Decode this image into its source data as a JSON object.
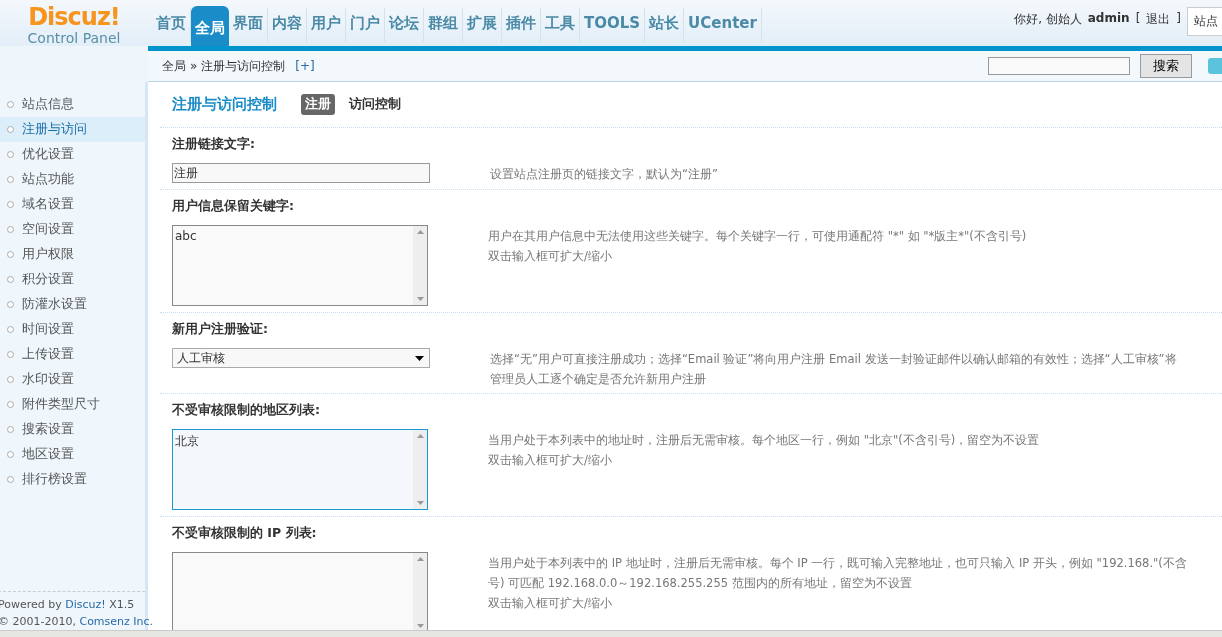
{
  "logo": {
    "name": "Discuz!",
    "subtitle": "Control Panel"
  },
  "nav": [
    {
      "label": "首页",
      "selected": false
    },
    {
      "label": "全局",
      "selected": true
    },
    {
      "label": "界面",
      "selected": false
    },
    {
      "label": "内容",
      "selected": false
    },
    {
      "label": "用户",
      "selected": false
    },
    {
      "label": "门户",
      "selected": false
    },
    {
      "label": "论坛",
      "selected": false
    },
    {
      "label": "群组",
      "selected": false
    },
    {
      "label": "扩展",
      "selected": false
    },
    {
      "label": "插件",
      "selected": false
    },
    {
      "label": "工具",
      "selected": false
    },
    {
      "label": "TOOLS",
      "selected": false
    },
    {
      "label": "站长",
      "selected": false
    },
    {
      "label": "UCenter",
      "selected": false
    }
  ],
  "user": {
    "greeting": "你好, 创始人",
    "name": "admin",
    "logout": "退出",
    "bracket_open": "[",
    "bracket_close": "]",
    "site_button": "站点"
  },
  "breadcrumb": {
    "parent": "全局",
    "separator": "»",
    "current": "注册与访问控制",
    "add": "[+]"
  },
  "search": {
    "button": "搜索"
  },
  "sidebar": {
    "items": [
      {
        "label": "站点信息",
        "selected": false
      },
      {
        "label": "注册与访问",
        "selected": true
      },
      {
        "label": "优化设置",
        "selected": false
      },
      {
        "label": "站点功能",
        "selected": false
      },
      {
        "label": "域名设置",
        "selected": false
      },
      {
        "label": "空间设置",
        "selected": false
      },
      {
        "label": "用户权限",
        "selected": false
      },
      {
        "label": "积分设置",
        "selected": false
      },
      {
        "label": "防灌水设置",
        "selected": false
      },
      {
        "label": "时间设置",
        "selected": false
      },
      {
        "label": "上传设置",
        "selected": false
      },
      {
        "label": "水印设置",
        "selected": false
      },
      {
        "label": "附件类型尺寸",
        "selected": false
      },
      {
        "label": "搜索设置",
        "selected": false
      },
      {
        "label": "地区设置",
        "selected": false
      },
      {
        "label": "排行榜设置",
        "selected": false
      }
    ],
    "footer": [
      {
        "prefix": "Powered by ",
        "link": "Discuz!",
        "suffix": " X1.5"
      },
      {
        "prefix": "© 2001-2010, ",
        "link": "Comsenz Inc."
      }
    ]
  },
  "page": {
    "title": "注册与访问控制",
    "subtabs": [
      {
        "label": "注册",
        "selected": true
      },
      {
        "label": "访问控制",
        "selected": false
      }
    ],
    "settings": [
      {
        "kind": "text",
        "label": "注册链接文字:",
        "value": "注册",
        "focused": false,
        "description": [
          "设置站点注册页的链接文字，默认为“注册”"
        ]
      },
      {
        "kind": "textarea",
        "label": "用户信息保留关键字:",
        "value": "abc",
        "focused": false,
        "description": [
          "用户在其用户信息中无法使用这些关键字。每个关键字一行，可使用通配符 \"*\" 如 \"*版主*\"(不含引号)",
          "双击输入框可扩大/缩小"
        ]
      },
      {
        "kind": "select",
        "label": "新用户注册验证:",
        "value": "人工审核",
        "focused": false,
        "description": [
          "选择“无”用户可直接注册成功；选择“Email 验证”将向用户注册 Email 发送一封验证邮件以确认邮箱的有效性；选择“人工审核”将",
          "管理员人工逐个确定是否允许新用户注册"
        ]
      },
      {
        "kind": "textarea",
        "label": "不受审核限制的地区列表:",
        "value": "北京",
        "focused": true,
        "description": [
          "当用户处于本列表中的地址时，注册后无需审核。每个地区一行，例如 \"北京\"(不含引号)，留空为不设置",
          "双击输入框可扩大/缩小"
        ]
      },
      {
        "kind": "textarea",
        "label": "不受审核限制的 IP 列表:",
        "focused": false,
        "description": [
          "当用户处于本列表中的 IP 地址时，注册后无需审核。每个 IP 一行，既可输入完整地址，也可只输入 IP 开头，例如 \"192.168.\"(不含",
          "号) 可匹配 192.168.0.0～192.168.255.255 范围内的所有地址，留空为不设置",
          "双击输入框可扩大/缩小"
        ]
      }
    ]
  }
}
